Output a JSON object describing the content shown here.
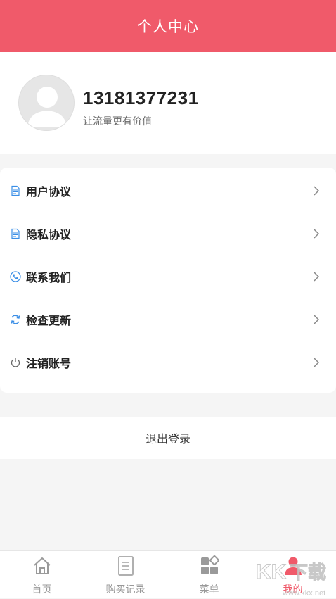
{
  "header": {
    "title": "个人中心"
  },
  "profile": {
    "phone": "13181377231",
    "slogan": "让流量更有价值"
  },
  "menu": {
    "items": [
      {
        "label": "用户协议",
        "icon": "document-icon"
      },
      {
        "label": "隐私协议",
        "icon": "document-icon"
      },
      {
        "label": "联系我们",
        "icon": "phone-icon"
      },
      {
        "label": "检查更新",
        "icon": "refresh-icon"
      },
      {
        "label": "注销账号",
        "icon": "power-icon"
      }
    ]
  },
  "logout": {
    "label": "退出登录"
  },
  "tabbar": {
    "tabs": [
      {
        "label": "首页",
        "icon": "home-icon"
      },
      {
        "label": "购买记录",
        "icon": "list-icon"
      },
      {
        "label": "菜单",
        "icon": "grid-icon"
      },
      {
        "label": "我的",
        "icon": "user-icon",
        "active": true
      }
    ]
  },
  "watermark": {
    "text": "KK下载",
    "url": "www.kkx.net"
  },
  "colors": {
    "accent": "#f05a6a",
    "icon_blue": "#3a8ee6",
    "inactive": "#999999"
  }
}
